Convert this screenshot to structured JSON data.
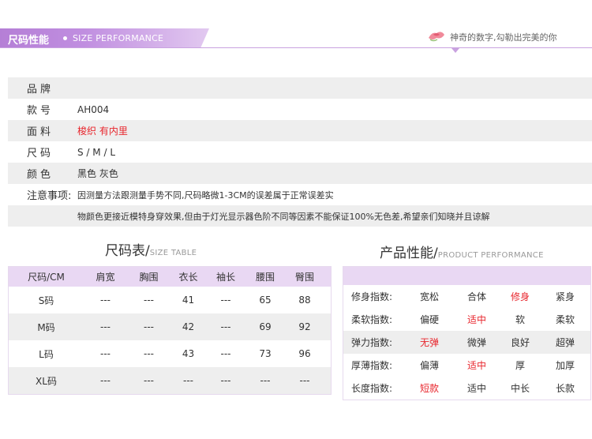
{
  "banner": {
    "title_cn": "尺码性能",
    "title_en": "SIZE PERFORMANCE",
    "slogan": "神奇的数字,勾勒出完美的你"
  },
  "info": {
    "rows": [
      {
        "label": "品牌",
        "value": "",
        "highlight": false
      },
      {
        "label": "款号",
        "value": "AH004",
        "highlight": false
      },
      {
        "label": "面料",
        "value": "梭织 有内里",
        "highlight": true
      },
      {
        "label": "尺码",
        "value": "S / M / L",
        "highlight": false
      },
      {
        "label": "颜色",
        "value": "黑色 灰色",
        "highlight": false
      }
    ],
    "note_label": "注意事项:",
    "note_line1": "因测量方法跟测量手势不同,尺码略微1-3CM的误差属于正常误差实",
    "note_line2": "物颜色更接近模特身穿效果,但由于灯光显示器色阶不同等因素不能保证100%无色差,希望亲们知晓并且谅解"
  },
  "size_section": {
    "title_cn": "尺码表/",
    "title_en": "SIZE TABLE"
  },
  "perf_section": {
    "title_cn": "产品性能/",
    "title_en": "PRODUCT PERFORMANCE"
  },
  "size_table": {
    "headers": [
      "尺码/CM",
      "肩宽",
      "胸围",
      "衣长",
      "袖长",
      "腰围",
      "臀围"
    ],
    "rows": [
      [
        "S码",
        "---",
        "---",
        "41",
        "---",
        "65",
        "88"
      ],
      [
        "M码",
        "---",
        "---",
        "42",
        "---",
        "69",
        "92"
      ],
      [
        "L码",
        "---",
        "---",
        "43",
        "---",
        "73",
        "96"
      ],
      [
        "XL码",
        "---",
        "---",
        "---",
        "---",
        "---",
        "---"
      ]
    ]
  },
  "perf_table": {
    "rows": [
      {
        "label": "修身指数:",
        "options": [
          "宽松",
          "合体",
          "修身",
          "紧身"
        ],
        "selected": 2
      },
      {
        "label": "柔软指数:",
        "options": [
          "偏硬",
          "适中",
          "软",
          "柔软"
        ],
        "selected": 1
      },
      {
        "label": "弹力指数:",
        "options": [
          "无弹",
          "微弹",
          "良好",
          "超弹"
        ],
        "selected": 0
      },
      {
        "label": "厚薄指数:",
        "options": [
          "偏薄",
          "适中",
          "厚",
          "加厚"
        ],
        "selected": 1
      },
      {
        "label": "长度指数:",
        "options": [
          "短款",
          "适中",
          "中长",
          "长款"
        ],
        "selected": 0
      }
    ]
  },
  "colors": {
    "accent_purple": "#b57fd6",
    "header_lavender": "#e9d8f3",
    "highlight_red": "#e8262d"
  }
}
